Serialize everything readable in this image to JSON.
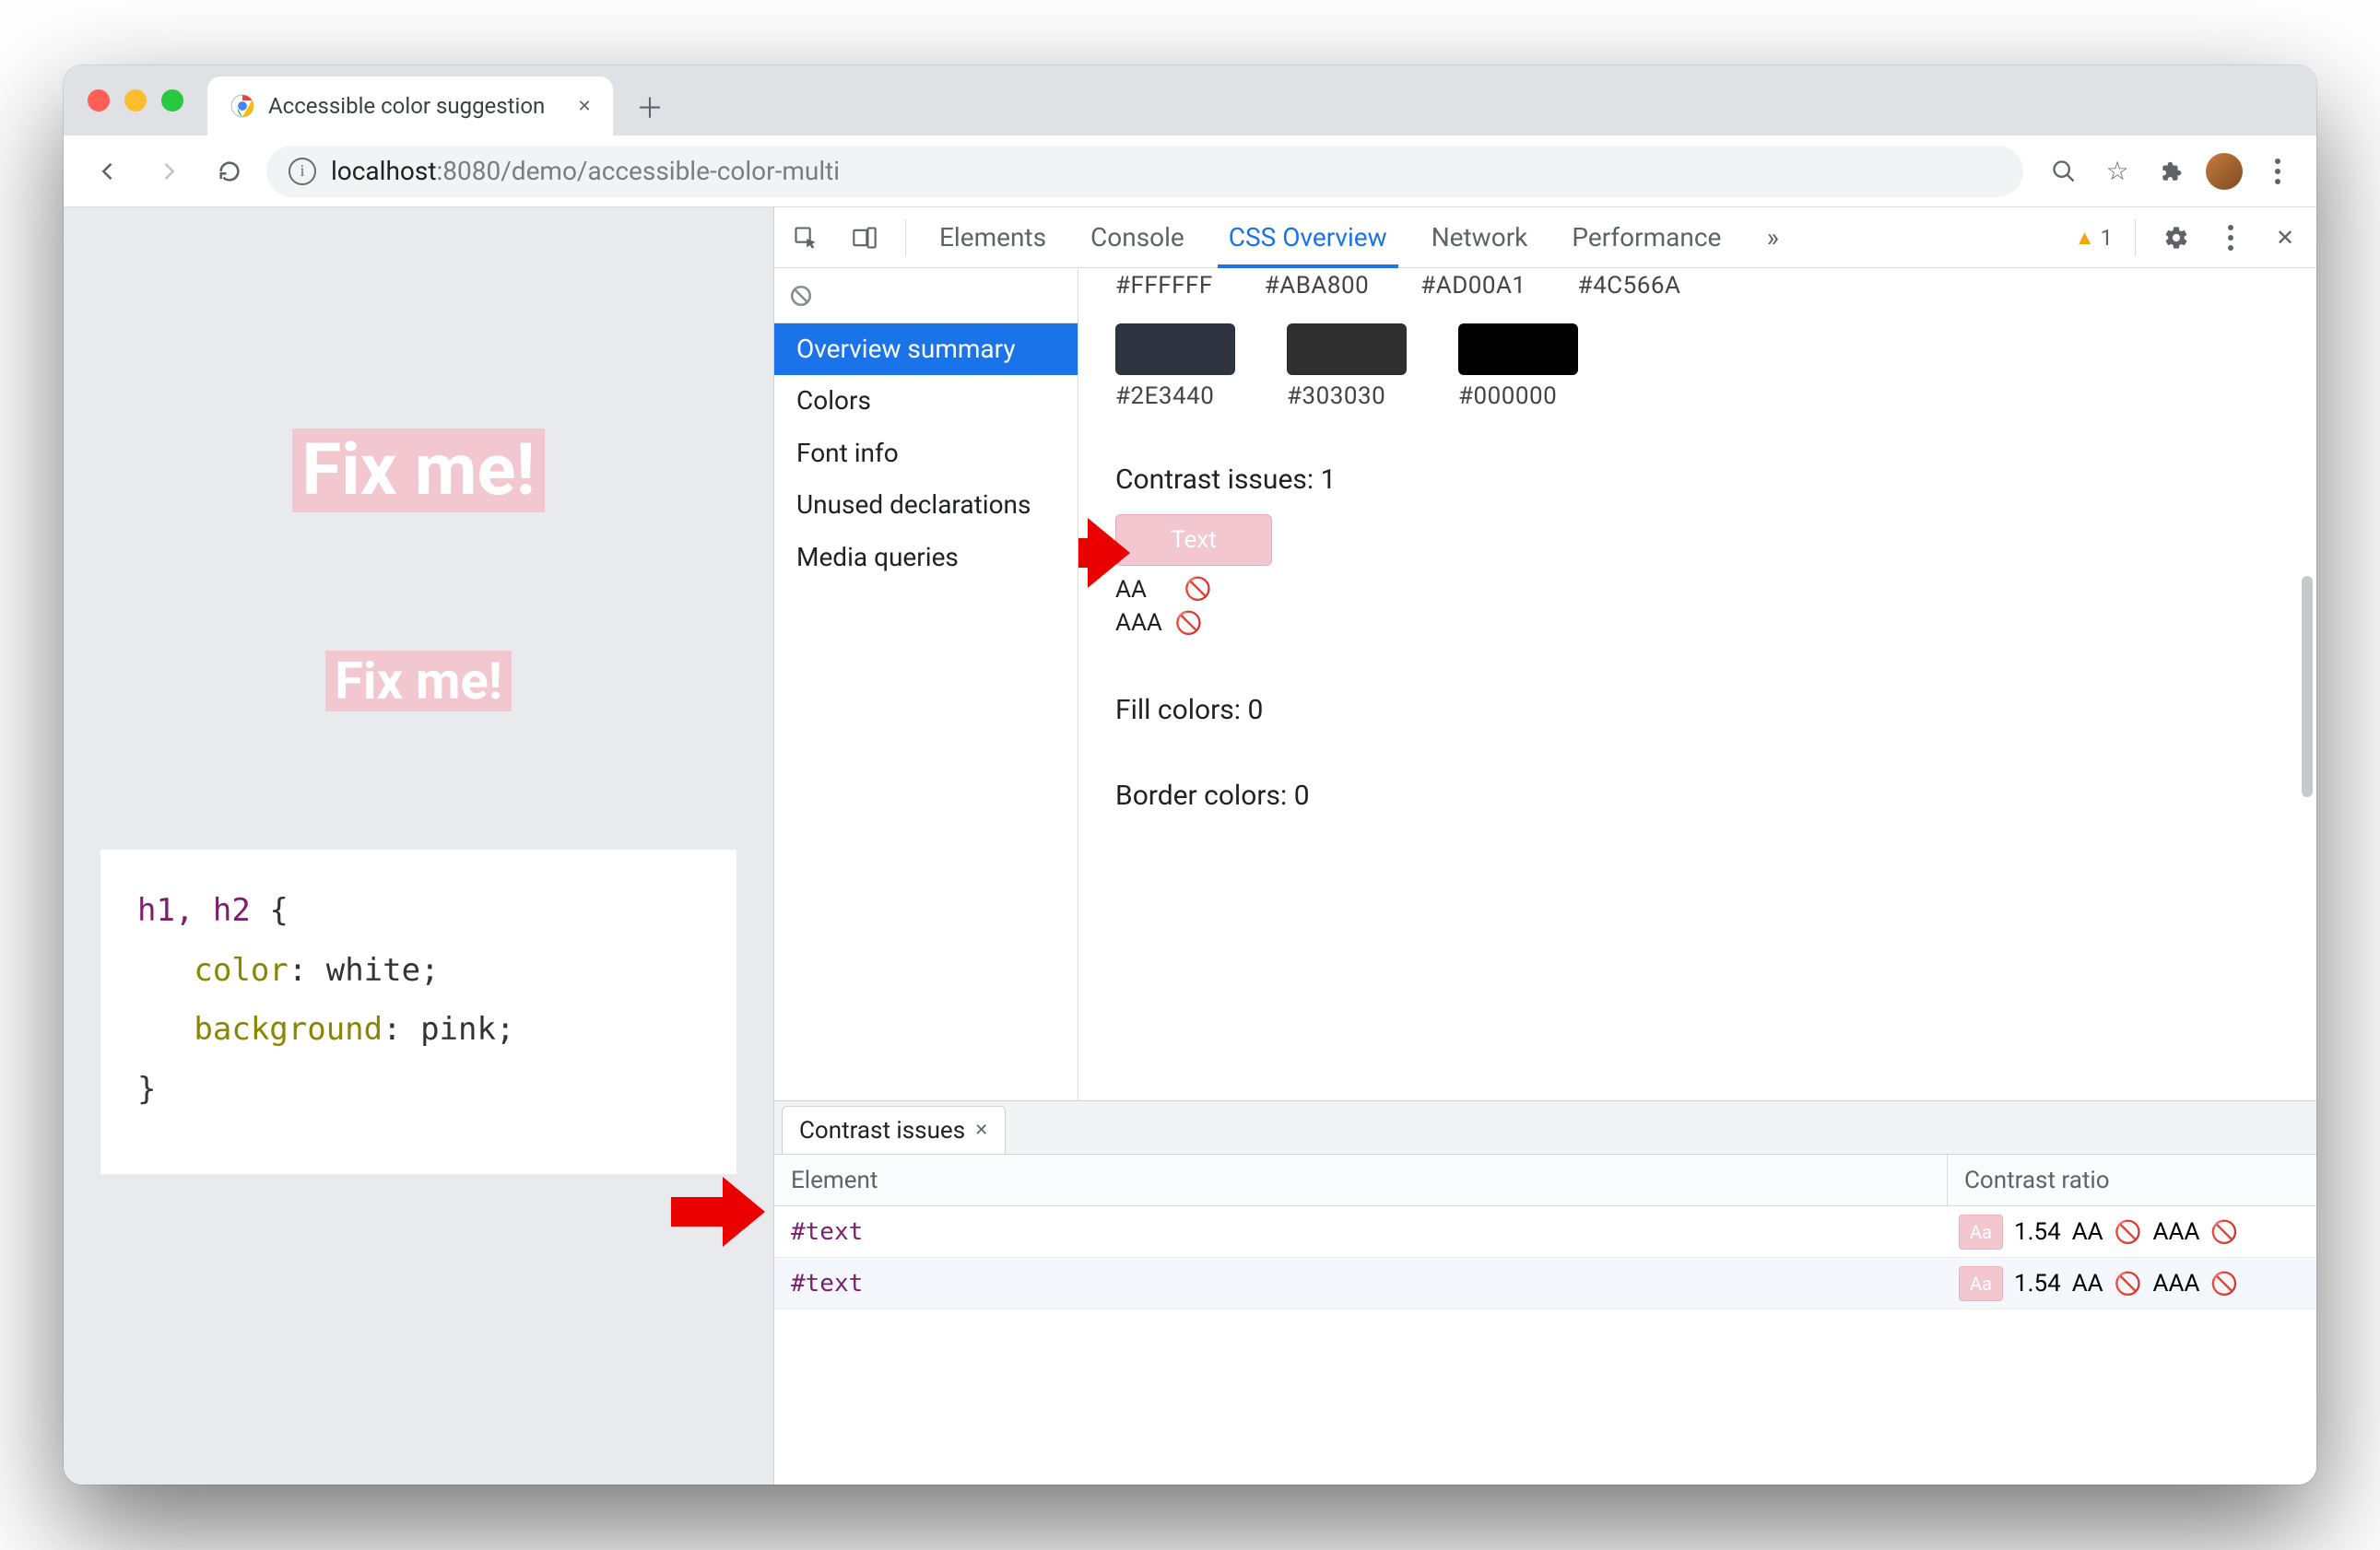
{
  "window": {
    "tab_title": "Accessible color suggestion"
  },
  "omnibox": {
    "host": "localhost",
    "port": ":8080",
    "path": "/demo/accessible-color-multi"
  },
  "toolbar_right": {
    "warning_count": "1"
  },
  "page": {
    "h1": "Fix me!",
    "h2": "Fix me!",
    "code": {
      "selector": "h1, h2",
      "open": "{",
      "prop1": "color",
      "val1": "white",
      "prop2": "background",
      "val2": "pink",
      "close": "}"
    }
  },
  "devtools": {
    "tabs": {
      "elements": "Elements",
      "console": "Console",
      "css_overview": "CSS Overview",
      "network": "Network",
      "performance": "Performance"
    },
    "sidebar": {
      "overview_summary": "Overview summary",
      "colors": "Colors",
      "font_info": "Font info",
      "unused_declarations": "Unused declarations",
      "media_queries": "Media queries"
    },
    "colors_top_labels": {
      "c1": "#FFFFFF",
      "c2": "#ABA800",
      "c3": "#AD00A1",
      "c4": "#4C566A"
    },
    "colors_bottom": {
      "c1_hex": "#2E3440",
      "c2_hex": "#303030",
      "c3_hex": "#000000",
      "c1_label": "#2E3440",
      "c2_label": "#303030",
      "c3_label": "#000000"
    },
    "sections": {
      "contrast_issues_title": "Contrast issues: 1",
      "contrast_swatch_text": "Text",
      "aa_label": "AA",
      "aaa_label": "AAA",
      "fill_colors": "Fill colors: 0",
      "border_colors": "Border colors: 0"
    },
    "drawer": {
      "tab_label": "Contrast issues",
      "header_element": "Element",
      "header_ratio": "Contrast ratio",
      "rows": [
        {
          "element": "#text",
          "swatch": "Aa",
          "ratio": "1.54",
          "aa": "AA",
          "aaa": "AAA"
        },
        {
          "element": "#text",
          "swatch": "Aa",
          "ratio": "1.54",
          "aa": "AA",
          "aaa": "AAA"
        }
      ]
    }
  }
}
